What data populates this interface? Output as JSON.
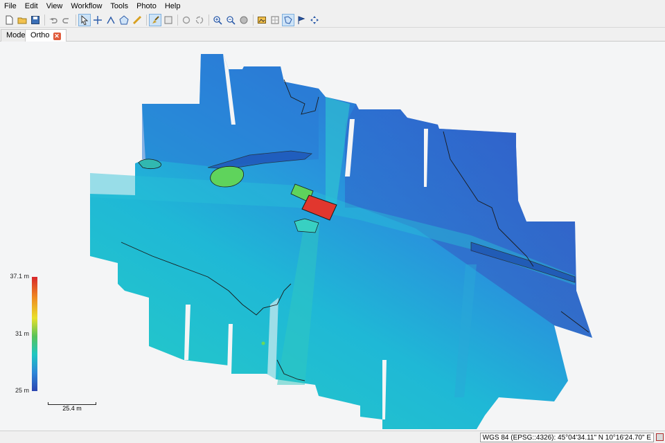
{
  "menu": [
    "File",
    "Edit",
    "View",
    "Workflow",
    "Tools",
    "Photo",
    "Help"
  ],
  "toolbar": {
    "buttons": [
      {
        "icon": "new-document-icon"
      },
      {
        "icon": "open-folder-icon"
      },
      {
        "icon": "save-icon"
      },
      {
        "icon": "undo-icon"
      },
      {
        "icon": "redo-icon"
      },
      {
        "icon": "select-arrow-icon",
        "active": true
      },
      {
        "icon": "move-crosshair-icon"
      },
      {
        "icon": "draw-polyline-icon"
      },
      {
        "icon": "draw-polygon-icon"
      },
      {
        "icon": "ruler-icon"
      },
      {
        "icon": "paint-brush-icon",
        "active": true
      },
      {
        "icon": "patch-icon"
      },
      {
        "icon": "rotate-left-icon"
      },
      {
        "icon": "rotate-right-icon"
      },
      {
        "icon": "zoom-in-icon"
      },
      {
        "icon": "zoom-out-icon"
      },
      {
        "icon": "reset-view-icon"
      },
      {
        "icon": "dem-icon"
      },
      {
        "icon": "orthomosaic-icon"
      },
      {
        "icon": "shapes-icon",
        "active": true
      },
      {
        "icon": "markers-icon"
      },
      {
        "icon": "navigate-icon"
      }
    ]
  },
  "tabs": {
    "model": "Model",
    "ortho": "Ortho",
    "close_glyph": "✕"
  },
  "legend": {
    "max_label": "37.1 m",
    "mid_label": "31 m",
    "min_label": "25 m",
    "scale_label": "25.4 m",
    "colors": [
      "#d7262b",
      "#ef8a22",
      "#e9e02a",
      "#58c35a",
      "#1ec6c2",
      "#2d86d8",
      "#2b44b0"
    ]
  },
  "status": {
    "coordinates": "WGS 84 (EPSG::4326): 45°04'34.11\" N  10°16'24.70\" E"
  }
}
